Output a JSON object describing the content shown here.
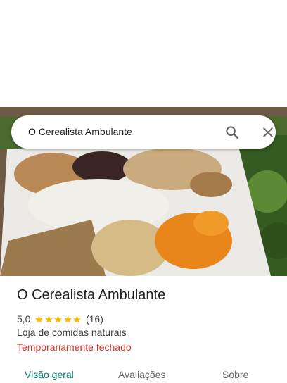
{
  "search": {
    "query": "O Cerealista Ambulante",
    "search_icon": "search-icon",
    "clear_icon": "close-icon"
  },
  "place": {
    "name": "O Cerealista Ambulante",
    "rating": "5,0",
    "stars": 5,
    "review_count": "(16)",
    "category": "Loja de comidas naturais",
    "status": "Temporariamente fechado"
  },
  "tabs": [
    {
      "label": "Visão geral",
      "active": true
    },
    {
      "label": "Avaliações",
      "active": false
    },
    {
      "label": "Sobre",
      "active": false
    }
  ],
  "colors": {
    "star": "#fbbc04",
    "status": "#d93025",
    "active_tab": "#00796b",
    "text": "#202124",
    "secondary": "#3c4043"
  }
}
